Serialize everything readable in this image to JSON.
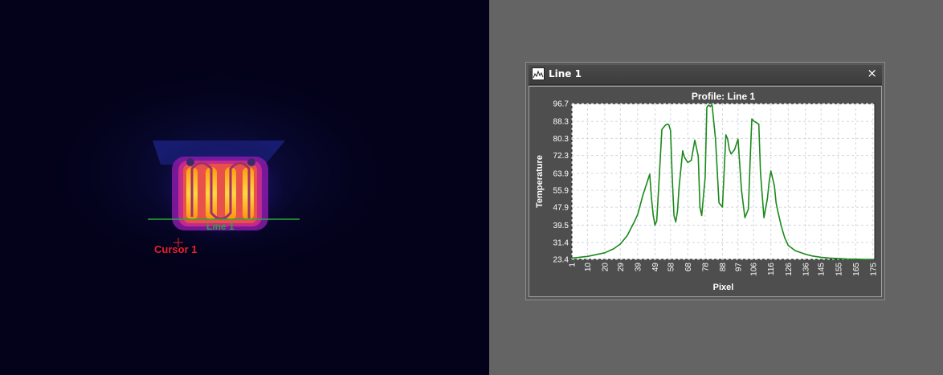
{
  "thermal_view": {
    "line_label": "Line 1",
    "cursor_label": "Cursor 1",
    "colors": {
      "background": "#03021a",
      "line": "#2aa63a",
      "cursor": "#e8202a"
    }
  },
  "window": {
    "title": "Line 1",
    "close_icon": "×"
  },
  "chart_data": {
    "type": "line",
    "title": "Profile: Line 1",
    "xlabel": "Pixel",
    "ylabel": "Temperature",
    "xlim": [
      1,
      176
    ],
    "ylim": [
      23.4,
      96.7
    ],
    "x_ticks": [
      "1",
      "10",
      "20",
      "29",
      "39",
      "49",
      "58",
      "68",
      "78",
      "88",
      "97",
      "106",
      "116",
      "126",
      "136",
      "145",
      "155",
      "165",
      "175"
    ],
    "y_ticks": [
      "96.7",
      "88.3",
      "80.3",
      "72.3",
      "63.9",
      "55.9",
      "47.9",
      "39.5",
      "31.4",
      "23.4"
    ],
    "grid": true,
    "series": [
      {
        "color": "#1a8a1a",
        "x": [
          1,
          10,
          20,
          25,
          29,
          33,
          37,
          39,
          42,
          44,
          46,
          47,
          48,
          49,
          50,
          51,
          53,
          55,
          56,
          57,
          58,
          59,
          60,
          61,
          62,
          63,
          65,
          66,
          68,
          70,
          72,
          74,
          75,
          76,
          78,
          79,
          80,
          81,
          82,
          84,
          86,
          88,
          90,
          91,
          92,
          93,
          95,
          97,
          99,
          101,
          103,
          104,
          105,
          106,
          108,
          109,
          110,
          112,
          114,
          115,
          116,
          118,
          119,
          120,
          122,
          124,
          126,
          130,
          136,
          140,
          145,
          150,
          155,
          160,
          165,
          170,
          175
        ],
        "y": [
          24.0,
          24.8,
          26.5,
          28.3,
          30.6,
          34.6,
          41.0,
          44.5,
          53.5,
          58.5,
          63.5,
          52.0,
          44.0,
          39.5,
          41.5,
          55.0,
          84.5,
          86.5,
          87.0,
          86.8,
          84.0,
          62.0,
          44.0,
          41.0,
          46.0,
          58.0,
          74.5,
          71.5,
          69.0,
          70.0,
          79.5,
          72.0,
          48.0,
          44.0,
          62.0,
          95.0,
          96.0,
          95.3,
          96.2,
          80.0,
          50.0,
          48.0,
          82.0,
          80.0,
          75.0,
          73.0,
          75.0,
          80.0,
          56.0,
          43.0,
          47.0,
          70.0,
          89.5,
          88.5,
          87.5,
          87.0,
          64.0,
          43.0,
          52.0,
          60.0,
          65.0,
          58.0,
          50.0,
          46.0,
          39.0,
          33.5,
          30.0,
          27.5,
          25.8,
          25.0,
          24.4,
          24.0,
          23.8,
          23.6,
          23.5,
          23.4,
          23.4
        ]
      }
    ]
  }
}
